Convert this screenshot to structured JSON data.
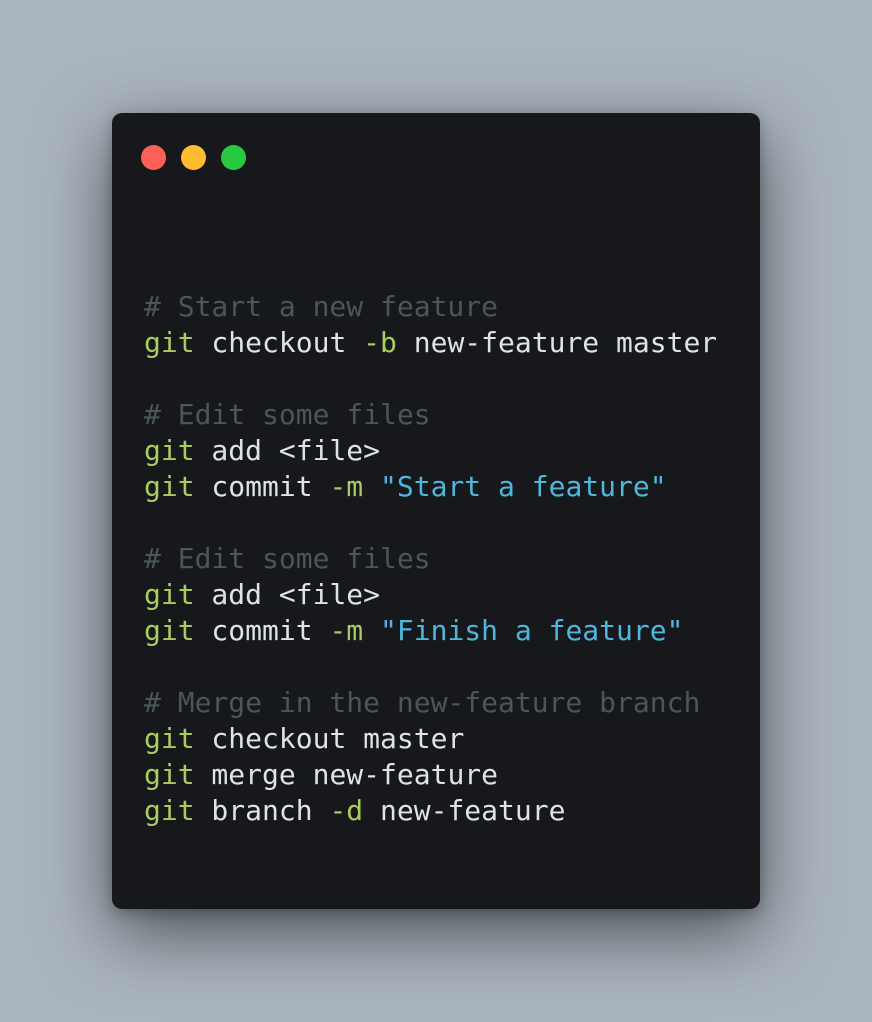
{
  "window": {
    "traffic_lights": [
      {
        "name": "close",
        "color": "#fe5f57"
      },
      {
        "name": "minimize",
        "color": "#febc2e"
      },
      {
        "name": "zoom",
        "color": "#28c840"
      }
    ]
  },
  "code": {
    "lines": [
      {
        "tokens": []
      },
      {
        "tokens": [
          {
            "type": "comment",
            "text": "# Start a new feature"
          }
        ]
      },
      {
        "tokens": [
          {
            "type": "cmd",
            "text": "git"
          },
          {
            "type": "plain",
            "text": " checkout "
          },
          {
            "type": "flag",
            "text": "-b"
          },
          {
            "type": "plain",
            "text": " new-feature master"
          }
        ]
      },
      {
        "tokens": []
      },
      {
        "tokens": [
          {
            "type": "comment",
            "text": "# Edit some files"
          }
        ]
      },
      {
        "tokens": [
          {
            "type": "cmd",
            "text": "git"
          },
          {
            "type": "plain",
            "text": " add <file>"
          }
        ]
      },
      {
        "tokens": [
          {
            "type": "cmd",
            "text": "git"
          },
          {
            "type": "plain",
            "text": " commit "
          },
          {
            "type": "flag",
            "text": "-m"
          },
          {
            "type": "plain",
            "text": " "
          },
          {
            "type": "string",
            "text": "\"Start a feature\""
          }
        ]
      },
      {
        "tokens": []
      },
      {
        "tokens": [
          {
            "type": "comment",
            "text": "# Edit some files"
          }
        ]
      },
      {
        "tokens": [
          {
            "type": "cmd",
            "text": "git"
          },
          {
            "type": "plain",
            "text": " add <file>"
          }
        ]
      },
      {
        "tokens": [
          {
            "type": "cmd",
            "text": "git"
          },
          {
            "type": "plain",
            "text": " commit "
          },
          {
            "type": "flag",
            "text": "-m"
          },
          {
            "type": "plain",
            "text": " "
          },
          {
            "type": "string",
            "text": "\"Finish a feature\""
          }
        ]
      },
      {
        "tokens": []
      },
      {
        "tokens": [
          {
            "type": "comment",
            "text": "# Merge in the new-feature branch"
          }
        ]
      },
      {
        "tokens": [
          {
            "type": "cmd",
            "text": "git"
          },
          {
            "type": "plain",
            "text": " checkout master"
          }
        ]
      },
      {
        "tokens": [
          {
            "type": "cmd",
            "text": "git"
          },
          {
            "type": "plain",
            "text": " merge new-feature"
          }
        ]
      },
      {
        "tokens": [
          {
            "type": "cmd",
            "text": "git"
          },
          {
            "type": "plain",
            "text": " branch "
          },
          {
            "type": "flag",
            "text": "-d"
          },
          {
            "type": "plain",
            "text": " new-feature"
          }
        ]
      }
    ]
  }
}
